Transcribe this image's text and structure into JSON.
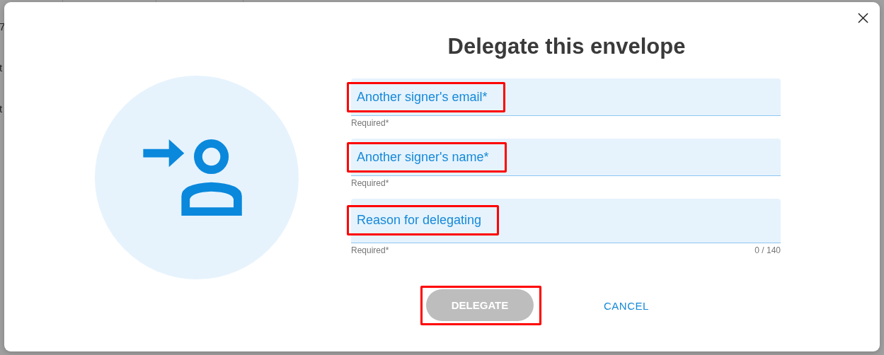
{
  "background": {
    "lines": [
      "7",
      "t",
      "t"
    ]
  },
  "dialog": {
    "title": "Delegate this envelope",
    "fields": [
      {
        "placeholder": "Another signer's email*",
        "helper": "Required*",
        "highlighted": true,
        "kind": "line"
      },
      {
        "placeholder": "Another signer's name*",
        "helper": "Required*",
        "highlighted": true,
        "kind": "line"
      },
      {
        "placeholder": "Reason for delegating",
        "helper": "Required*",
        "counter": "0 / 140",
        "highlighted": true,
        "kind": "area"
      }
    ],
    "buttons": [
      {
        "label": "DELEGATE",
        "kind": "primary",
        "disabled": true,
        "highlighted": true
      },
      {
        "label": "CANCEL",
        "kind": "text",
        "disabled": false,
        "highlighted": false
      }
    ]
  }
}
